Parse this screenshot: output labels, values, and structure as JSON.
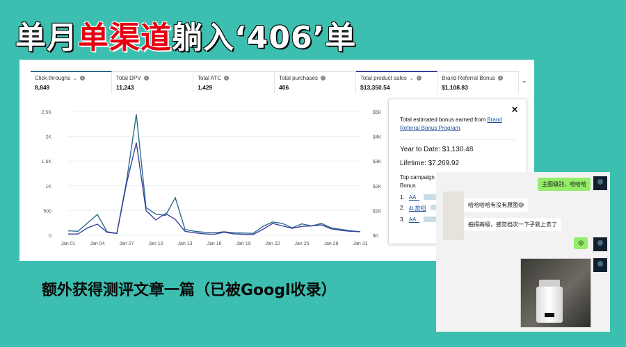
{
  "headline": {
    "part1": "单月",
    "part2_red": "单渠道",
    "part3": "躺入‘406’单"
  },
  "tabs": [
    {
      "label": "Click-throughs",
      "value": "8,849",
      "has_dropdown": true
    },
    {
      "label": "Total DPV",
      "value": "11,243",
      "has_dropdown": false
    },
    {
      "label": "Total ATC",
      "value": "1,429",
      "has_dropdown": false
    },
    {
      "label": "Total purchases",
      "value": "406",
      "has_dropdown": false
    },
    {
      "label": "Total product sales",
      "value": "$13,350.54",
      "has_dropdown": true
    },
    {
      "label": "Brand Referral Bonus",
      "value": "$1,108.83",
      "has_dropdown": false
    }
  ],
  "tabs_more": "⌄",
  "chart_data": {
    "type": "line",
    "title": "",
    "x": [
      "Jan 01",
      "Jan 02",
      "Jan 03",
      "Jan 04",
      "Jan 05",
      "Jan 06",
      "Jan 07",
      "Jan 08",
      "Jan 09",
      "Jan 10",
      "Jan 11",
      "Jan 12",
      "Jan 13",
      "Jan 14",
      "Jan 15",
      "Jan 16",
      "Jan 17",
      "Jan 18",
      "Jan 19",
      "Jan 20",
      "Jan 21",
      "Jan 22",
      "Jan 23",
      "Jan 24",
      "Jan 25",
      "Jan 26",
      "Jan 27",
      "Jan 28",
      "Jan 29",
      "Jan 30",
      "Jan 31"
    ],
    "x_tick_labels": [
      "Jan 01",
      "Jan 04",
      "Jan 07",
      "Jan 10",
      "Jan 13",
      "Jan 16",
      "Jan 19",
      "Jan 22",
      "Jan 25",
      "Jan 28",
      "Jan 31"
    ],
    "left_axis": {
      "ticks": [
        "2.5K",
        "2K",
        "1.5K",
        "1K",
        "500",
        "0"
      ],
      "ylim": [
        0,
        2500
      ]
    },
    "right_axis": {
      "ticks": [
        "$5K",
        "$4K",
        "$3K",
        "$2K",
        "$1K",
        "$0"
      ],
      "ylim": [
        0,
        5000
      ]
    },
    "grid": true,
    "series": [
      {
        "color": "#2b6b8a",
        "axis": "left",
        "values": [
          90,
          80,
          250,
          420,
          70,
          40,
          1100,
          2450,
          560,
          430,
          400,
          760,
          120,
          80,
          60,
          50,
          70,
          50,
          45,
          40,
          180,
          270,
          240,
          150,
          230,
          190,
          240,
          150,
          120,
          90,
          70
        ]
      },
      {
        "color": "#3b3f9e",
        "axis": "right",
        "values": [
          50,
          50,
          300,
          450,
          120,
          70,
          2100,
          3750,
          1000,
          620,
          880,
          640,
          160,
          100,
          60,
          40,
          120,
          60,
          40,
          30,
          240,
          480,
          380,
          280,
          360,
          380,
          420,
          260,
          200,
          160,
          150
        ]
      }
    ]
  },
  "popup": {
    "intro": "Total estimated bonus earned from ",
    "link": "Brand Referral Bonus Program",
    "intro_end": ".",
    "ytd": "Year to Date: $1,130.48",
    "lifetime": "Lifetime: $7,269.92",
    "top_label": "Top campaign",
    "top_label2": "Bonus",
    "campaigns": [
      {
        "num": "1.",
        "name": "AA_"
      },
      {
        "num": "2.",
        "name": "4L旋钮"
      },
      {
        "num": "3.",
        "name": "AA_"
      }
    ]
  },
  "subtitle": "额外获得测评文章一篇（已被Googl收录）",
  "chat": {
    "msg1": "主图级别，哈哈哈",
    "msg2": "哈哈哈哈有没有原图",
    "msg2_emoji": "😅",
    "msg3": "拍得高级，感觉档次一下子就上去了",
    "msg4_emoji": "😜"
  },
  "colors": {
    "background": "#3cbfb0",
    "headline_red": "#e60012",
    "chat_bubble_green": "#95ec69"
  }
}
